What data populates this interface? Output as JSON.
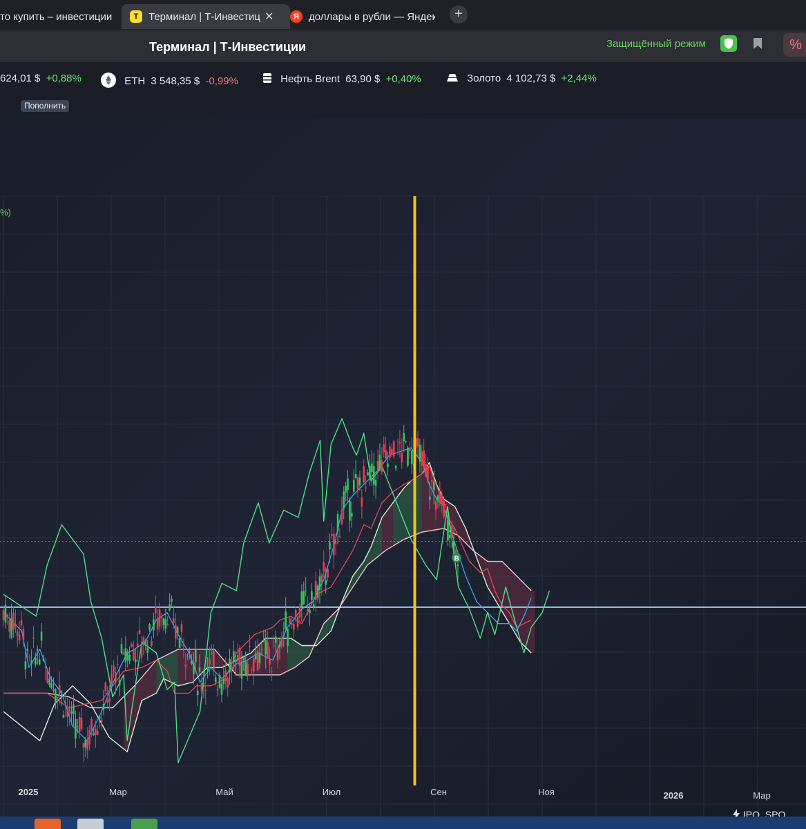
{
  "browser": {
    "tabs": [
      {
        "title": "то купить – инвестиции",
        "active": false,
        "icon": "page-icon"
      },
      {
        "title": "Терминал | Т-Инвестиции",
        "active": true,
        "icon": "t-bank-logo-icon"
      },
      {
        "title": "доллары в рубли — Яндекс",
        "active": false,
        "icon": "yandex-logo-icon"
      }
    ],
    "close_glyph": "✕",
    "new_tab_glyph": "+",
    "page_title": "Терминал | Т-Инвестиции",
    "protected_mode": "Защищённый режим",
    "percent_glyph": "%",
    "yandex_glyph": "Я",
    "tbank_glyph": "T"
  },
  "ticker": [
    {
      "name": "",
      "price": "624,01 $",
      "change": "+0,88%",
      "dir": "up",
      "icon": ""
    },
    {
      "name": "ETH",
      "price": "3 548,35 $",
      "change": "-0,99%",
      "dir": "down",
      "icon": "ethereum-icon"
    },
    {
      "name": "Нефть Brent",
      "price": "63,90 $",
      "change": "+0,40%",
      "dir": "up",
      "icon": "oil-barrel-icon"
    },
    {
      "name": "Золото",
      "price": "4 102,73 $",
      "change": "+2,44%",
      "dir": "up",
      "icon": "gold-bars-icon"
    }
  ],
  "toolbar": {
    "topup_label": "Пополнить"
  },
  "chart_left_label": "%)",
  "status": {
    "exchange_label": "IPO, SPO"
  },
  "colors": {
    "background": "#1c2130",
    "candle_up": "#2ec95a",
    "candle_down": "#ef3b50",
    "tenkan": "#3aa7f0",
    "kijun": "#ec4458",
    "chikou": "#4fdf84",
    "span_a": "#d8f0d8",
    "span_b": "#f2c2c9",
    "cloud_bull": "#2f6a48",
    "cloud_bear": "#6b2f45",
    "marker": "#f4c21a",
    "hline": "#9ec7ef"
  },
  "chart_data": {
    "type": "candlestick",
    "indicator": "ichimoku",
    "x_ticks": [
      "2025",
      "Мар",
      "Май",
      "Июл",
      "Сен",
      "Ноя",
      "2026",
      "Мар"
    ],
    "ylim": [
      0,
      100
    ],
    "y_ticks_visible": false,
    "grid": true,
    "series": [
      {
        "key": "chikou",
        "x": [
          0,
          9,
          12,
          16,
          22,
          24,
          27,
          30,
          33,
          34,
          38,
          42,
          45,
          47,
          48,
          54,
          57,
          60,
          64,
          66,
          70,
          73,
          77,
          81,
          84,
          87,
          88,
          90,
          93,
          96,
          97,
          99,
          101,
          104,
          108,
          112,
          116,
          119,
          122,
          125,
          128,
          131,
          133,
          135,
          138,
          141,
          143,
          145,
          148,
          150
        ],
        "values": [
          49,
          43,
          57,
          68,
          60,
          47,
          37,
          21,
          27,
          9,
          36,
          33,
          23,
          25,
          3,
          17,
          44,
          52,
          50,
          63,
          74,
          63,
          72,
          70,
          82,
          91,
          69,
          90,
          97,
          89,
          87,
          93,
          80,
          84,
          74,
          64,
          57,
          53,
          73,
          51,
          45,
          37,
          44,
          38,
          51,
          40,
          33,
          40,
          44,
          50
        ]
      },
      {
        "key": "tenkan",
        "x": [
          0,
          5,
          7,
          10,
          13,
          16,
          19,
          23,
          27,
          31,
          34,
          36,
          39,
          42,
          45,
          48,
          51,
          54,
          57,
          60,
          64,
          67,
          70,
          74,
          78,
          82,
          85,
          88,
          91,
          93,
          96,
          99,
          101,
          103,
          106,
          109,
          112,
          115,
          117,
          119,
          121,
          124,
          127,
          130,
          133,
          136,
          139,
          141,
          143,
          145
        ],
        "values": [
          44,
          39,
          29,
          34,
          26,
          22,
          13,
          9,
          17,
          27,
          33,
          34,
          36,
          42,
          44,
          38,
          33,
          25,
          29,
          26,
          30,
          31,
          33,
          31,
          40,
          45,
          47,
          53,
          63,
          72,
          76,
          79,
          81,
          83,
          87,
          88,
          89,
          85,
          79,
          75,
          73,
          63,
          54,
          47,
          44,
          41,
          41,
          39,
          43,
          48
        ]
      },
      {
        "key": "kijun",
        "x": [
          0,
          12,
          18,
          27,
          33,
          38,
          42,
          45,
          47,
          51,
          53,
          57,
          61,
          64,
          66,
          69,
          74,
          76,
          79,
          82,
          86,
          90,
          93,
          96,
          99,
          101,
          104,
          107,
          110,
          112,
          115,
          117,
          120,
          122,
          124,
          128,
          131,
          133,
          135,
          137,
          139,
          141,
          143,
          145
        ],
        "values": [
          22,
          22,
          18,
          20,
          28,
          29,
          31,
          28,
          22,
          22,
          24,
          24,
          26,
          33,
          35,
          38,
          40,
          42,
          43,
          41,
          49,
          51,
          56,
          61,
          68,
          67,
          74,
          77,
          79,
          80,
          82,
          84,
          76,
          70,
          67,
          58,
          55,
          56,
          50,
          46,
          44,
          40,
          41,
          42
        ]
      },
      {
        "key": "span_a",
        "x": [
          0,
          10,
          14,
          19,
          24,
          29,
          34,
          38,
          42,
          44,
          48,
          52,
          56,
          60,
          64,
          68,
          72,
          76,
          79,
          82,
          86,
          90,
          93,
          96,
          99,
          101,
          104,
          107,
          110,
          112,
          115,
          117,
          119,
          121,
          124,
          127,
          130,
          133,
          136,
          139,
          142,
          145
        ],
        "values": [
          17,
          9,
          19,
          24,
          19,
          10,
          6,
          20,
          22,
          26,
          24,
          25,
          29,
          29,
          31,
          33,
          37,
          37,
          37,
          35,
          35,
          39,
          47,
          54,
          58,
          62,
          70,
          74,
          78,
          80,
          82,
          85,
          79,
          75,
          73,
          67,
          59,
          51,
          46,
          41,
          36,
          33
        ]
      },
      {
        "key": "span_b",
        "x": [
          0,
          12,
          18,
          24,
          30,
          36,
          42,
          46,
          48,
          53,
          58,
          64,
          70,
          76,
          80,
          84,
          88,
          92,
          96,
          100,
          105,
          110,
          115,
          121,
          125,
          129,
          133,
          137,
          141,
          145
        ],
        "values": [
          22,
          22,
          21,
          18,
          18,
          24,
          31,
          33,
          34,
          34,
          34,
          27,
          27,
          27,
          29,
          32,
          41,
          45,
          51,
          57,
          61,
          64,
          66,
          67,
          65,
          61,
          58,
          58,
          54,
          50
        ]
      }
    ],
    "cloud_bull_ranges": [
      [
        42,
        48
      ],
      [
        55,
        58
      ],
      [
        78,
        104
      ],
      [
        107,
        115
      ]
    ],
    "cloud_bear_ranges": [
      [
        33,
        42
      ],
      [
        48,
        55
      ],
      [
        58,
        78
      ],
      [
        104,
        107
      ],
      [
        115,
        146
      ]
    ],
    "hlines": [
      {
        "key": "hline",
        "y": 45.5,
        "style": "solid"
      },
      {
        "key": "hline",
        "y": 63.5,
        "style": "dotted"
      }
    ],
    "vline": {
      "key": "marker",
      "x": 113
    },
    "signal": {
      "x": 124.5,
      "y": 59,
      "label": "B"
    }
  }
}
